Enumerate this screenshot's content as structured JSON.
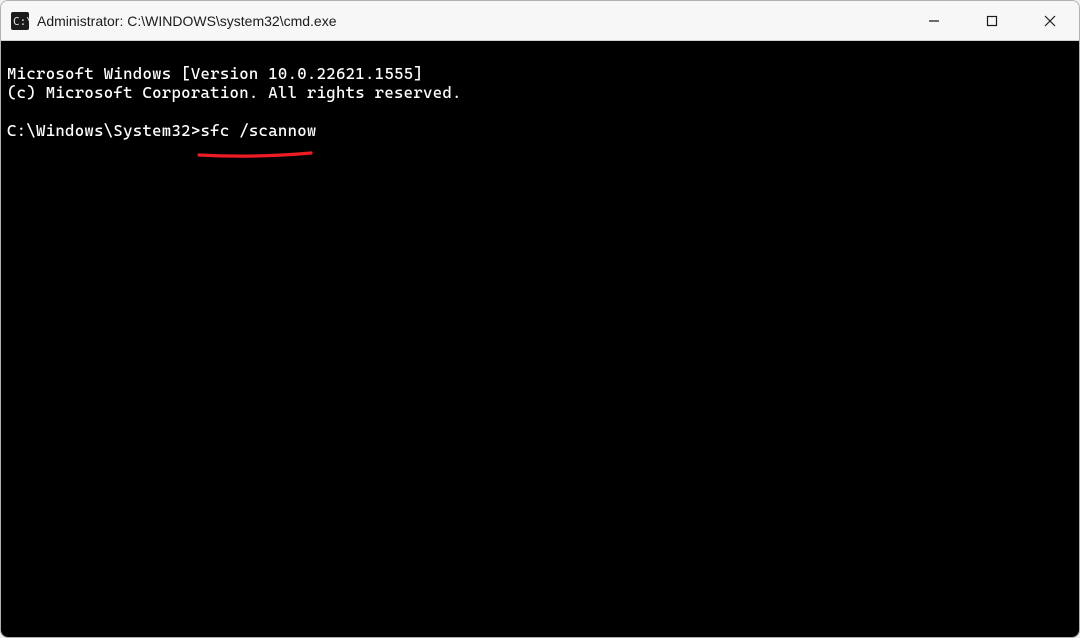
{
  "window": {
    "title": "Administrator: C:\\WINDOWS\\system32\\cmd.exe"
  },
  "terminal": {
    "banner_line1": "Microsoft Windows [Version 10.0.22621.1555]",
    "banner_line2": "(c) Microsoft Corporation. All rights reserved.",
    "blank": "",
    "prompt": "C:\\Windows\\System32>",
    "command": "sfc /scannow"
  },
  "annotation": {
    "color": "#ef1c24"
  }
}
